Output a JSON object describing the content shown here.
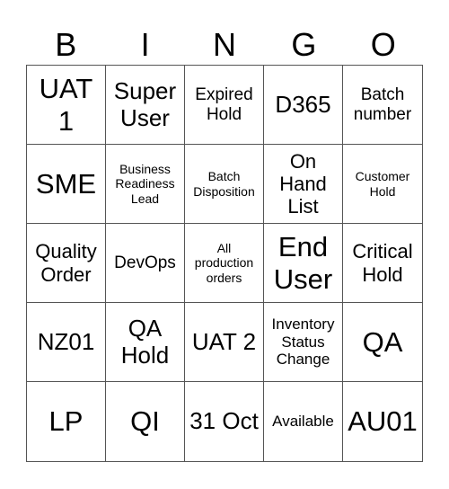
{
  "header": [
    "B",
    "I",
    "N",
    "G",
    "O"
  ],
  "cells": [
    [
      "UAT 1",
      "Super User",
      "Expired Hold",
      "D365",
      "Batch number"
    ],
    [
      "SME",
      "Business Readiness Lead",
      "Batch Disposition",
      "On Hand List",
      "Customer Hold"
    ],
    [
      "Quality Order",
      "DevOps",
      "All production orders",
      "End User",
      "Critical Hold"
    ],
    [
      "NZ01",
      "QA Hold",
      "UAT 2",
      "Inventory Status Change",
      "QA"
    ],
    [
      "LP",
      "QI",
      "31 Oct",
      "Available",
      "AU01"
    ]
  ]
}
